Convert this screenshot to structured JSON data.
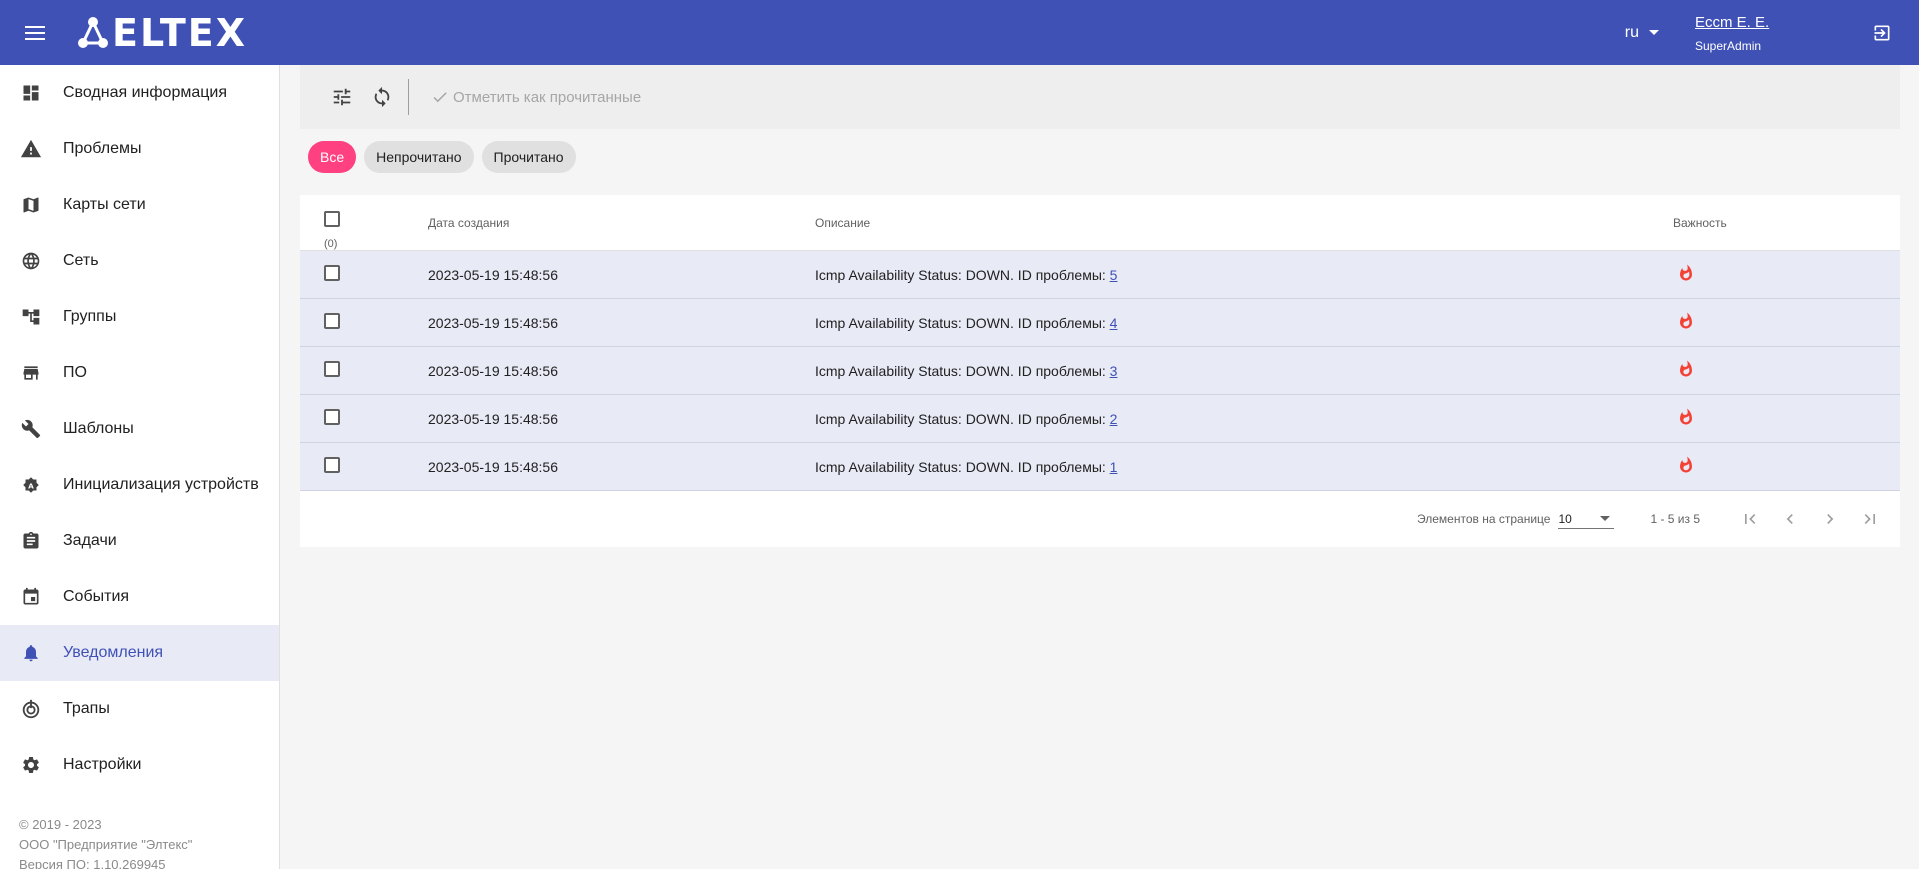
{
  "header": {
    "logo_text": "ELTEX",
    "lang": "ru",
    "user_name": "Eccm E. E.",
    "user_role": "SuperAdmin"
  },
  "sidebar": {
    "items": [
      {
        "label": "Сводная информация",
        "icon": "dashboard-icon"
      },
      {
        "label": "Проблемы",
        "icon": "warning-icon"
      },
      {
        "label": "Карты сети",
        "icon": "map-icon"
      },
      {
        "label": "Сеть",
        "icon": "globe-icon"
      },
      {
        "label": "Группы",
        "icon": "tree-icon"
      },
      {
        "label": "ПО",
        "icon": "store-icon"
      },
      {
        "label": "Шаблоны",
        "icon": "wrench-icon"
      },
      {
        "label": "Инициализация устройств",
        "icon": "auto-gear-icon"
      },
      {
        "label": "Задачи",
        "icon": "clipboard-icon"
      },
      {
        "label": "События",
        "icon": "calendar-icon"
      },
      {
        "label": "Уведомления",
        "icon": "bell-icon",
        "active": true
      },
      {
        "label": "Трапы",
        "icon": "trap-icon"
      },
      {
        "label": "Настройки",
        "icon": "gear-icon"
      }
    ],
    "footer": {
      "copyright": "© 2019 - 2023",
      "company": "ООО \"Предприятие \"Элтекс\"",
      "version": "Версия ПО: 1.10.269945"
    }
  },
  "toolbar": {
    "mark_read_label": "Отметить как прочитанные"
  },
  "filters": {
    "all": "Все",
    "unread": "Непрочитано",
    "read": "Прочитано",
    "active": "all"
  },
  "table": {
    "selected_count": "(0)",
    "columns": {
      "date": "Дата создания",
      "description": "Описание",
      "severity": "Важность"
    },
    "rows": [
      {
        "date": "2023-05-19 15:48:56",
        "desc": "Icmp Availability Status: DOWN. ID проблемы: ",
        "problem_id": "5"
      },
      {
        "date": "2023-05-19 15:48:56",
        "desc": "Icmp Availability Status: DOWN. ID проблемы: ",
        "problem_id": "4"
      },
      {
        "date": "2023-05-19 15:48:56",
        "desc": "Icmp Availability Status: DOWN. ID проблемы: ",
        "problem_id": "3"
      },
      {
        "date": "2023-05-19 15:48:56",
        "desc": "Icmp Availability Status: DOWN. ID проблемы: ",
        "problem_id": "2"
      },
      {
        "date": "2023-05-19 15:48:56",
        "desc": "Icmp Availability Status: DOWN. ID проблемы: ",
        "problem_id": "1"
      }
    ]
  },
  "paginator": {
    "per_page_label": "Элементов на странице",
    "per_page": "10",
    "range": "1 - 5 из 5"
  },
  "colors": {
    "primary": "#3f51b5",
    "accent": "#ff4081",
    "severity": "#f44336"
  }
}
